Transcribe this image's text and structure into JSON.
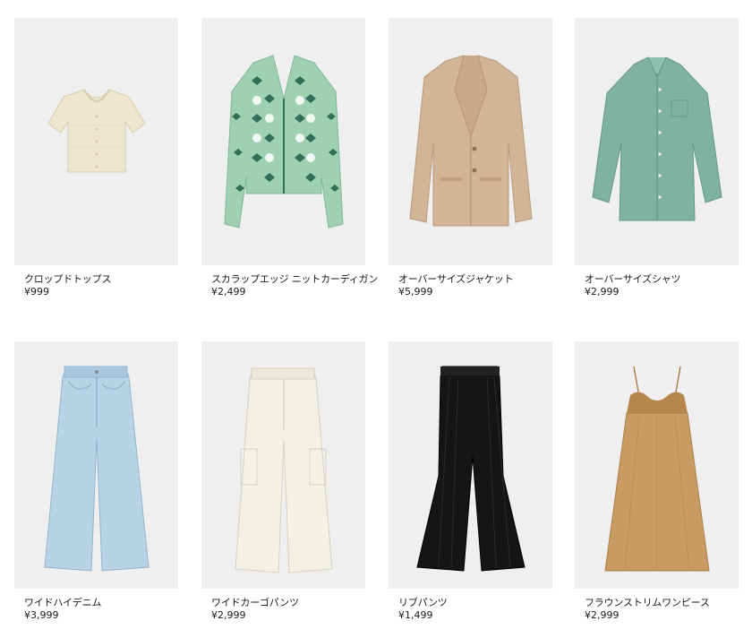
{
  "products": [
    {
      "name": "クロップドトップス",
      "price": "¥999",
      "icon": "crop-top-image",
      "color": "#efe6cf"
    },
    {
      "name": "スカラップエッジ ニットカーディガン",
      "price": "¥2,499",
      "icon": "knit-cardigan-image",
      "color": "#9fd0b1"
    },
    {
      "name": "オーバーサイズジャケット",
      "price": "¥5,999",
      "icon": "oversized-jacket-image",
      "color": "#d2b496"
    },
    {
      "name": "オーバーサイズシャツ",
      "price": "¥2,999",
      "icon": "oversized-shirt-image",
      "color": "#7fb3a0"
    },
    {
      "name": "ワイドハイデニム",
      "price": "¥3,999",
      "icon": "wide-denim-image",
      "color": "#b9d3e6"
    },
    {
      "name": "ワイドカーゴパンツ",
      "price": "¥2,999",
      "icon": "cargo-pants-image",
      "color": "#f3f0e4"
    },
    {
      "name": "リブパンツ",
      "price": "¥1,499",
      "icon": "rib-pants-image",
      "color": "#151515"
    },
    {
      "name": "フラウンストリムワンピース",
      "price": "¥2,999",
      "icon": "flounce-dress-image",
      "color": "#c99a62"
    }
  ]
}
